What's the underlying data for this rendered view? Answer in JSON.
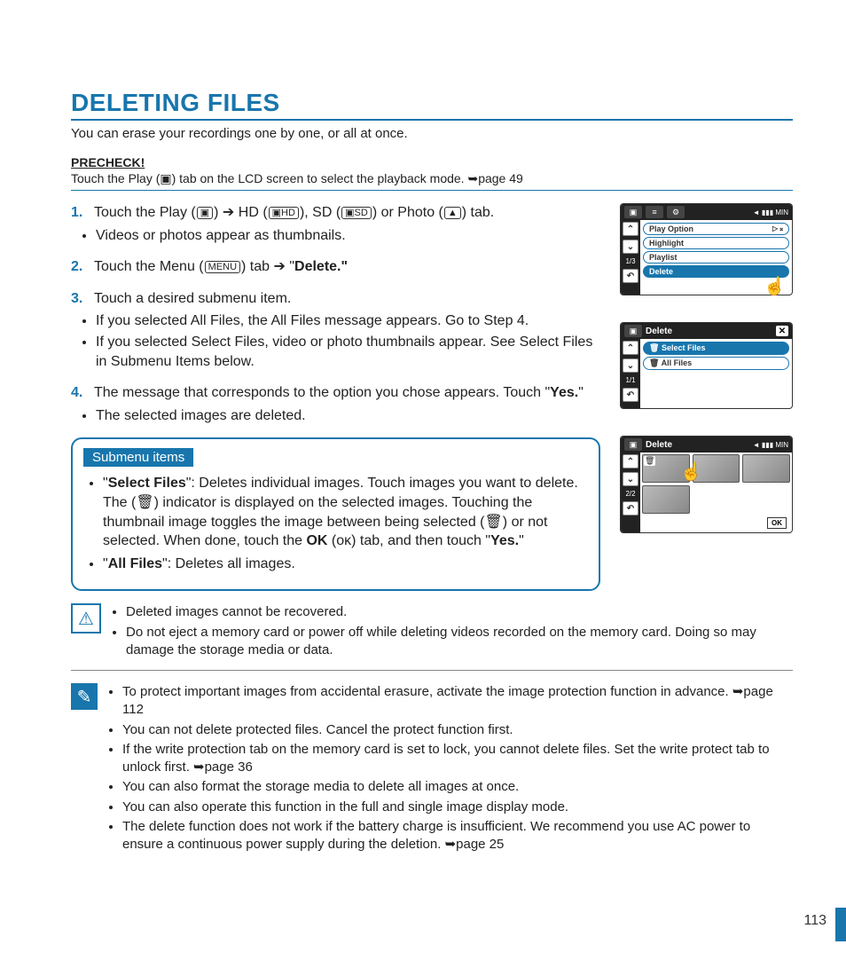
{
  "title": "DELETING FILES",
  "intro": "You can erase your recordings one by one, or all at once.",
  "precheck_label": "PRECHECK!",
  "precheck_text": "Touch the Play (▣) tab on the LCD screen to select the playback mode. ➥page 49",
  "steps": {
    "s1_a": "Touch the Play (",
    "s1_b": ") ➔ HD (",
    "s1_c": "), SD (",
    "s1_d": ") or Photo (",
    "s1_e": ") tab.",
    "s1_sub1": "Videos or photos appear as thumbnails.",
    "s2_a": "Touch the Menu (",
    "s2_b": ") tab ➔ \"",
    "s2_c": "Delete.\"",
    "s3": "Touch a desired submenu item.",
    "s3_sub1": "If you selected All Files, the All Files message appears. Go to Step 4.",
    "s3_sub2": "If you selected Select Files, video or photo thumbnails appear. See Select Files in Submenu Items below.",
    "s4_a": "The message that corresponds to the option you chose appears. Touch \"",
    "s4_b": "Yes.",
    "s4_c": "\"",
    "s4_sub1": "The selected images are deleted."
  },
  "submenu": {
    "title": "Submenu items",
    "sf_a": "\"",
    "sf_b": "Select Files",
    "sf_c": "\": Deletes individual images. Touch images you want to delete. The (🗑) indicator is displayed on the selected images. Touching the thumbnail image toggles the image between being selected (🗑) or not selected. When done, touch the ",
    "sf_d": "OK",
    "sf_e": " (oᴋ) tab, and then touch \"",
    "sf_f": "Yes.",
    "sf_g": "\"",
    "af_a": "\"",
    "af_b": "All Files",
    "af_c": "\": Deletes all images."
  },
  "warn": {
    "w1": "Deleted images cannot be recovered.",
    "w2": "Do not eject a memory card or power off while deleting videos recorded on the memory card. Doing so may damage the storage media or data."
  },
  "info": {
    "i1": "To protect important images from accidental erasure, activate the image protection function in advance. ➥page 112",
    "i2": "You can not delete protected files. Cancel the protect function first.",
    "i3": "If the write protection tab on the memory card is set to lock, you cannot delete files. Set the write protect tab to unlock first. ➥page 36",
    "i4": "You can also format the storage media to delete all images at once.",
    "i5": "You can also operate this function in the full and single image display mode.",
    "i6": "The delete function does not work if the battery charge is insufficient. We recommend you use AC power to ensure a continuous power supply during the deletion. ➥page 25"
  },
  "icons": {
    "play": "▣",
    "hd": "▣HD",
    "sd": "▣SD",
    "photo": "▲",
    "menu": "MENU",
    "ok": "OK"
  },
  "page_number": "113",
  "lcd1": {
    "page": "1/3",
    "items": [
      "Play Option",
      "Highlight",
      "Playlist",
      "Delete"
    ],
    "play_right": "▷ 𝄪"
  },
  "lcd2": {
    "title": "Delete",
    "page": "1/1",
    "items": [
      "Select Files",
      "All Files"
    ]
  },
  "lcd3": {
    "title": "Delete",
    "page": "2/2",
    "ok": "OK"
  }
}
